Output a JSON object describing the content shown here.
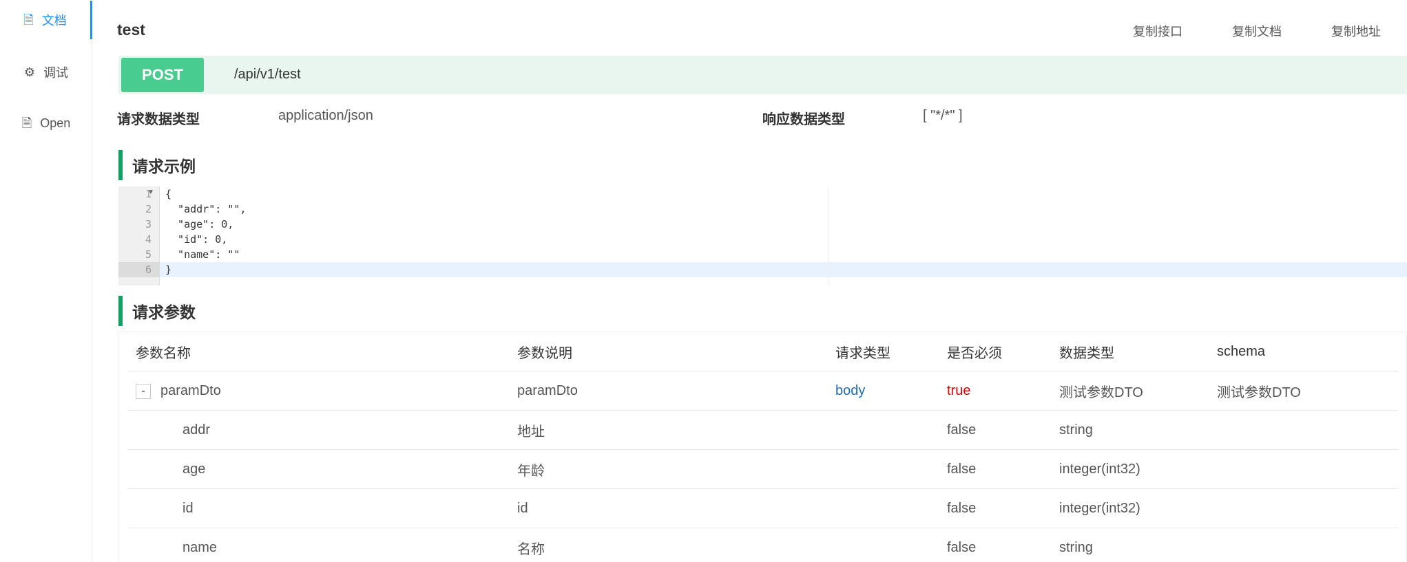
{
  "sidebar": {
    "items": [
      {
        "label": "文档",
        "icon": "document-icon",
        "active": true
      },
      {
        "label": "调试",
        "icon": "bug-icon",
        "active": false
      },
      {
        "label": "Open",
        "icon": "file-icon",
        "active": false
      }
    ]
  },
  "header": {
    "title": "test",
    "actions": [
      "复制接口",
      "复制文档",
      "复制地址"
    ]
  },
  "endpoint": {
    "method": "POST",
    "path": "/api/v1/test",
    "method_color": "#49cc90"
  },
  "content_types": {
    "request_label": "请求数据类型",
    "request_value": "application/json",
    "response_label": "响应数据类型",
    "response_value": "[ \"*/*\" ]"
  },
  "request_example": {
    "title": "请求示例",
    "line_numbers": [
      "1",
      "2",
      "3",
      "4",
      "5",
      "6"
    ],
    "lines": [
      "{",
      "  \"addr\": \"\",",
      "  \"age\": 0,",
      "  \"id\": 0,",
      "  \"name\": \"\"",
      "}"
    ]
  },
  "request_params": {
    "title": "请求参数",
    "columns": [
      "参数名称",
      "参数说明",
      "请求类型",
      "是否必须",
      "数据类型",
      "schema"
    ],
    "toggle": "-",
    "rows": [
      {
        "name": "paramDto",
        "desc": "paramDto",
        "in": "body",
        "required": "true",
        "type": "测试参数DTO",
        "schema": "测试参数DTO"
      },
      {
        "name": "addr",
        "desc": "地址",
        "in": "",
        "required": "false",
        "type": "string",
        "schema": ""
      },
      {
        "name": "age",
        "desc": "年龄",
        "in": "",
        "required": "false",
        "type": "integer(int32)",
        "schema": ""
      },
      {
        "name": "id",
        "desc": "id",
        "in": "",
        "required": "false",
        "type": "integer(int32)",
        "schema": ""
      },
      {
        "name": "name",
        "desc": "名称",
        "in": "",
        "required": "false",
        "type": "string",
        "schema": ""
      }
    ]
  },
  "colors": {
    "accent": "#1890ff",
    "section_bar": "#10a060",
    "required_true": "#e00000",
    "body_blue": "#1e6bb8"
  }
}
